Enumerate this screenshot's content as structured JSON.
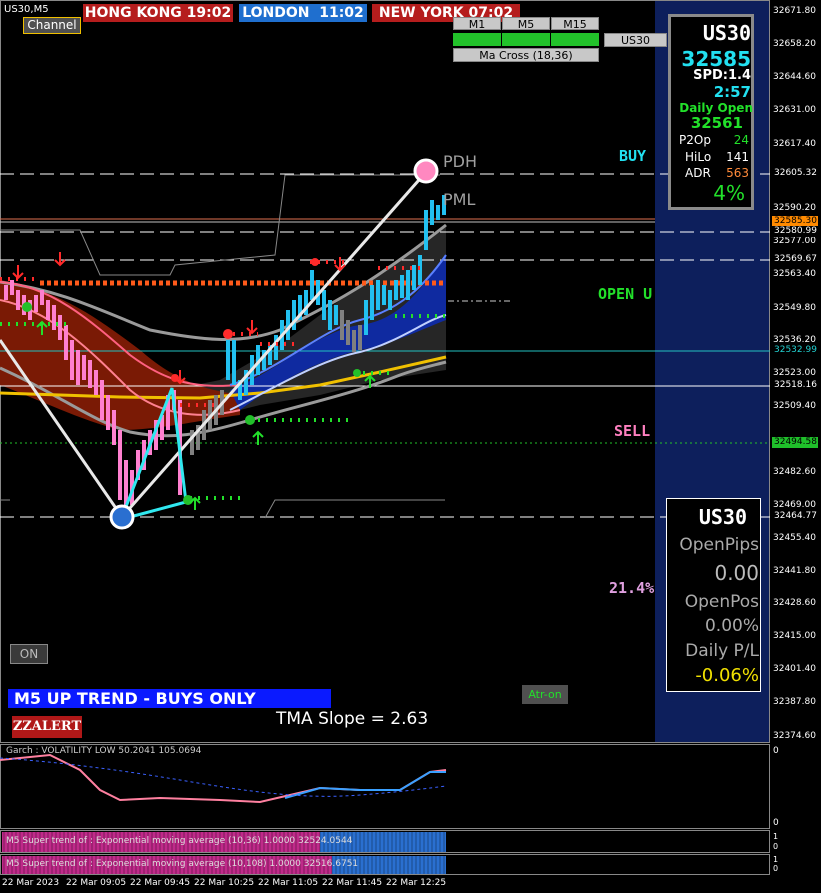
{
  "symbol_label": "US30,M5",
  "channel_button": "Channel",
  "sessions": [
    {
      "name": "HONG KONG",
      "time": "19:02",
      "color": "#b51d1d"
    },
    {
      "name": "LONDON",
      "time": "11:02",
      "color": "#1f6fcf"
    },
    {
      "name": "NEW YORK",
      "time": "07:02",
      "color": "#b51d1d"
    }
  ],
  "timeframes": {
    "m1": "M1",
    "m5": "M5",
    "m15": "M15",
    "symbol": "US30",
    "ma_cross": "Ma Cross (18,36)"
  },
  "info_panel": {
    "symbol": "US30",
    "price": "32585",
    "spread_label": "SPD:",
    "spread_value": "1.4",
    "timer": "2:57",
    "daily_open_label": "Daily Open",
    "daily_open_value": "32561",
    "p2o_label": "P2Op",
    "p2o_value": "24",
    "hilo_label": "HiLo",
    "hilo_value": "141",
    "adr_label": "ADR",
    "adr_value": "563",
    "percent": "4%"
  },
  "pos_panel": {
    "symbol": "US30",
    "open_pips_label": "OpenPips",
    "open_pips_value": "0.00",
    "open_pos_label": "OpenPos",
    "open_pos_value": "0.00%",
    "daily_pl_label": "Daily P/L",
    "daily_pl_value": "-0.06%"
  },
  "level_labels": {
    "pdh": "PDH",
    "pml": "PML",
    "buy": "BUY",
    "open": "OPEN U",
    "sell": "SELL",
    "pct": "21.4%"
  },
  "on_button": "ON",
  "atr_button": "Atr-on",
  "trend_banner": "M5 UP TREND - BUYS ONLY",
  "zzalert": "ZZALERT",
  "tma_slope": "TMA Slope = 2.63",
  "price_axis": [
    "32671.80",
    "32658.20",
    "32644.60",
    "32631.00",
    "32617.40",
    "32590.20",
    "32577.00",
    "32563.40",
    "32549.80",
    "32536.20",
    "32523.00",
    "32509.40",
    "32482.60",
    "32469.00",
    "32455.40",
    "32441.80",
    "32428.60",
    "32415.00",
    "32401.40",
    "32387.80",
    "32374.60"
  ],
  "price_tags": [
    {
      "text": "32605.32",
      "bg": "#000000",
      "fg": "#ffffff"
    },
    {
      "text": "32585.30",
      "bg": "#ff8a00",
      "fg": "#000000"
    },
    {
      "text": "32580.99",
      "bg": "#000000",
      "fg": "#ffffff"
    },
    {
      "text": "32569.67",
      "bg": "#000000",
      "fg": "#ffffff"
    },
    {
      "text": "32532.99",
      "bg": "#000000",
      "fg": "#22d0d0"
    },
    {
      "text": "32518.16",
      "bg": "#000000",
      "fg": "#ffffff"
    },
    {
      "text": "32494.58",
      "bg": "#1fbf2a",
      "fg": "#000000"
    },
    {
      "text": "32464.77",
      "bg": "#000000",
      "fg": "#ffffff"
    }
  ],
  "time_axis": [
    "22 Mar 2023",
    "22 Mar 09:05",
    "22 Mar 09:45",
    "22 Mar 10:25",
    "22 Mar 11:05",
    "22 Mar 11:45",
    "22 Mar 12:25"
  ],
  "garch_label": "Garch : VOLATILITY LOW 50.2041 105.0694",
  "garch_axis": [
    "0",
    "0"
  ],
  "super_trend_1": "M5  Super trend of : Exponential moving average (10,36)  1.0000 32524.0544",
  "super_trend_2": "M5  Super trend of : Exponential moving average (10,108)  1.0000 32516.6751",
  "st_axis_1": [
    "1",
    "0"
  ],
  "st_axis_2": [
    "1",
    "0"
  ]
}
